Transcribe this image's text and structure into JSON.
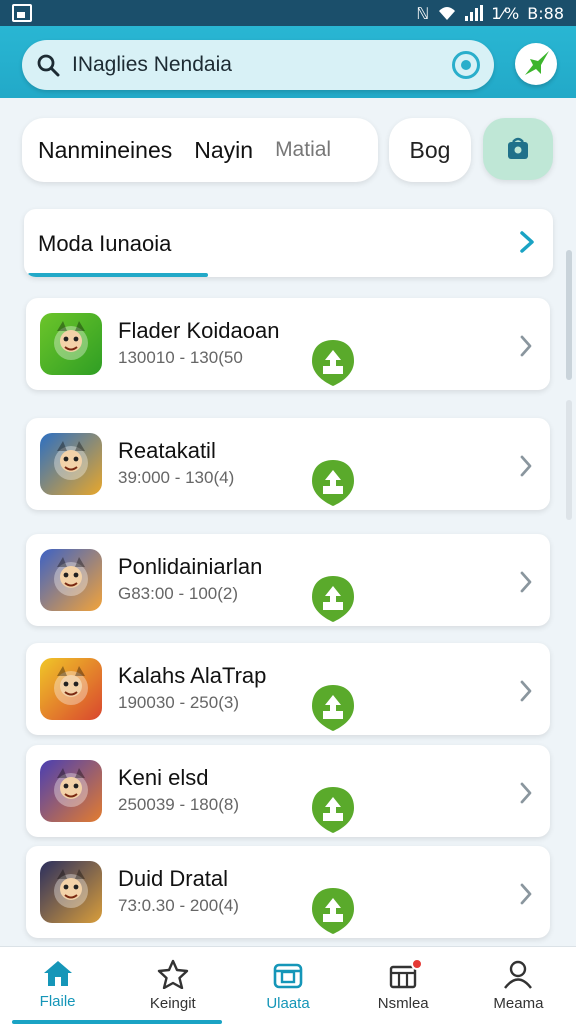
{
  "status_bar": {
    "indicator_left": "ℕ",
    "battery_text": "1⁄%",
    "time": "B:88"
  },
  "search": {
    "text": "INaglies Nendaia"
  },
  "filters": {
    "chip_1": "Nanmineines",
    "chip_2": "Nayin",
    "chip_3": "Matial",
    "blog": "Bog"
  },
  "section": {
    "title": "Moda Iunaoia",
    "progress": 0.34
  },
  "apps": [
    {
      "name": "Flader Koidaoan",
      "meta": "130010 - 130(50",
      "icon": "sun-mascot-icon",
      "bg": [
        "#6cc52a",
        "#2f9e24"
      ]
    },
    {
      "name": "Reatakatil",
      "meta": "39:000 - 130(4)",
      "icon": "goblin-hero-icon",
      "bg": [
        "#2c6fc2",
        "#e8a72b"
      ]
    },
    {
      "name": "Ponlidainiarlan",
      "meta": "G83:00 - 100(2)",
      "icon": "ninja-cat-icon",
      "bg": [
        "#3d62c4",
        "#f2a33a"
      ]
    },
    {
      "name": "Kalahs AlaTrap",
      "meta": "190030 - 250(3)",
      "icon": "fox-warrior-icon",
      "bg": [
        "#f0c628",
        "#d9462e"
      ]
    },
    {
      "name": "Keni elsd",
      "meta": "250039 - 180(8)",
      "icon": "wolf-mage-icon",
      "bg": [
        "#4a3fb2",
        "#e37c2f"
      ]
    },
    {
      "name": "Duid Dratal",
      "meta": "73:0.30 - 200(4)",
      "icon": "heroine-portrait-icon",
      "bg": [
        "#2b2f5e",
        "#d99e3b"
      ]
    }
  ],
  "nav": [
    {
      "label": "Flaile",
      "icon": "home-icon"
    },
    {
      "label": "Keingit",
      "icon": "star-icon"
    },
    {
      "label": "Ulaata",
      "icon": "store-icon"
    },
    {
      "label": "Nsmlea",
      "icon": "gift-icon"
    },
    {
      "label": "Meama",
      "icon": "profile-icon"
    }
  ],
  "colors": {
    "header": "#22a9c8",
    "status_bar": "#1b4f6b",
    "install": "#5aaa2b",
    "accent": "#1aa3c4"
  }
}
